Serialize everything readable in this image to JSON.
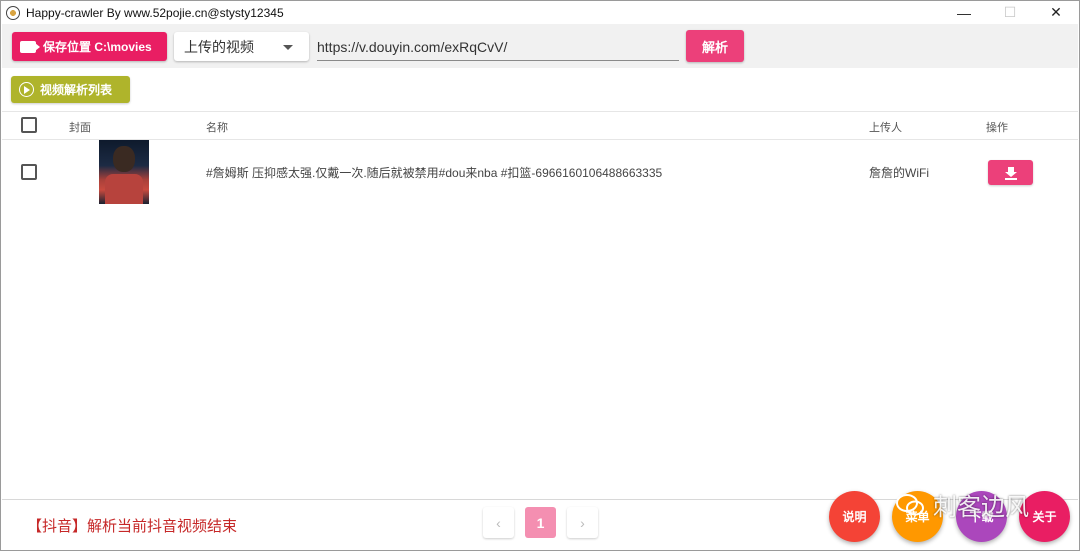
{
  "window": {
    "title": "Happy-crawler By www.52pojie.cn@stysty12345",
    "minimize": "—",
    "maximize": "☐",
    "close": "✕"
  },
  "toolbar": {
    "save_label": "保存位置 C:\\movies",
    "select_value": "上传的视频",
    "url_value": "https://v.douyin.com/exRqCvV/",
    "parse_label": "解析"
  },
  "list": {
    "title": "视频解析列表"
  },
  "table": {
    "headers": {
      "cover": "封面",
      "name": "名称",
      "uploader": "上传人",
      "action": "操作"
    },
    "rows": [
      {
        "name": "#詹姆斯 压抑感太强.仅戴一次.随后就被禁用#dou来nba #扣篮-6966160106488663335",
        "uploader": "詹詹的WiFi"
      }
    ]
  },
  "footer": {
    "status": "【抖音】解析当前抖音视频结束",
    "pagination": {
      "prev": "‹",
      "current": "1",
      "next": "›"
    }
  },
  "fabs": [
    {
      "label": "说明",
      "color": "#f44336"
    },
    {
      "label": "菜单",
      "color": "#ff9800"
    },
    {
      "label": "下载",
      "color": "#ab47bc"
    },
    {
      "label": "关于",
      "color": "#e91e63"
    }
  ],
  "watermark": {
    "text": "刺客边风"
  }
}
